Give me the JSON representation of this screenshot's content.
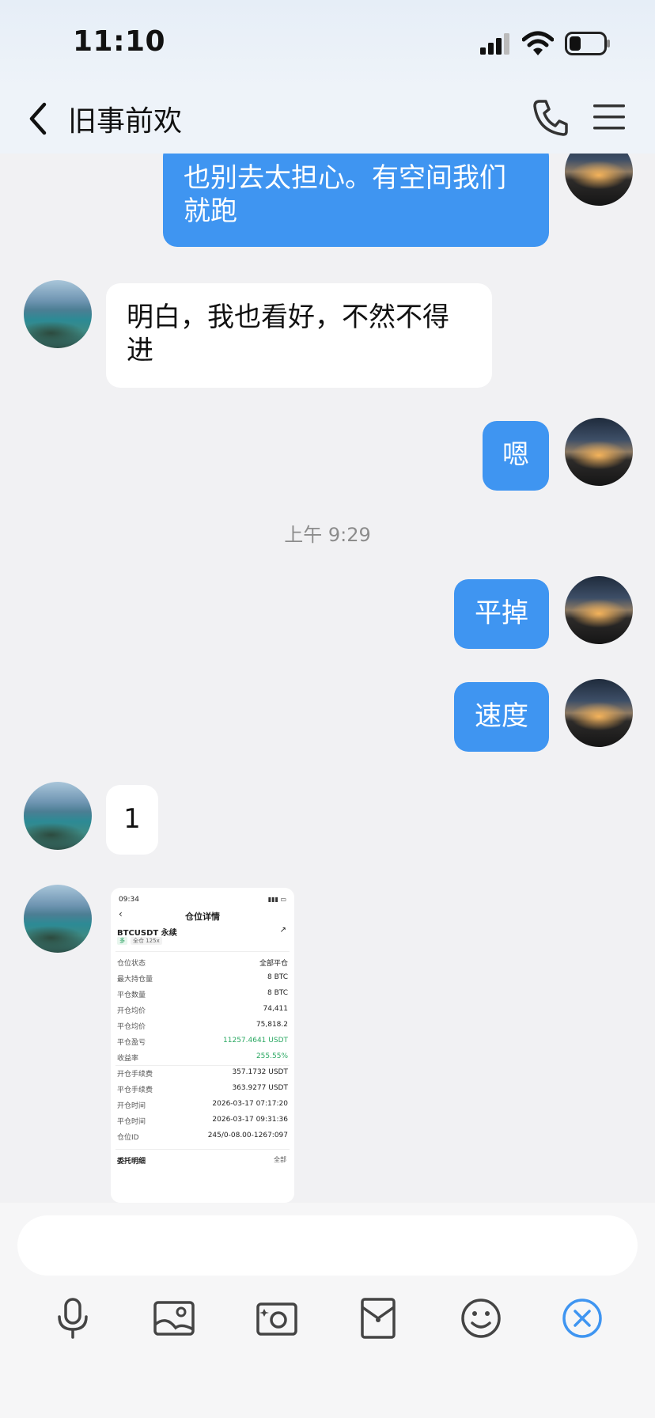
{
  "status_bar": {
    "time": "11:10"
  },
  "header": {
    "title": "旧事前欢",
    "icons": [
      "back-icon",
      "phone-icon",
      "menu-icon"
    ]
  },
  "messages": [
    {
      "side": "out",
      "text": "也别去太担心。有空间我们就跑"
    },
    {
      "side": "in",
      "text": "明白，我也看好，不然不得进"
    },
    {
      "side": "out",
      "text": "嗯"
    },
    {
      "timestamp": "上午 9:29"
    },
    {
      "side": "out",
      "text": "平掉"
    },
    {
      "side": "out",
      "text": "速度"
    },
    {
      "side": "in",
      "text": "1"
    },
    {
      "side": "in",
      "type": "image"
    }
  ],
  "screenshot": {
    "time": "09:34",
    "title": "仓位详情",
    "symbol": "BTCUSDT 永续",
    "tag_long": "多",
    "tag_leverage": "全仓 125x",
    "rows": [
      {
        "k": "仓位状态",
        "v": "全部平仓"
      },
      {
        "k": "最大持仓量",
        "v": "8 BTC"
      },
      {
        "k": "平仓数量",
        "v": "8 BTC"
      },
      {
        "k": "开仓均价",
        "v": "74,411"
      },
      {
        "k": "平仓均价",
        "v": "75,818.2"
      },
      {
        "k": "平仓盈亏",
        "v": "11257.4641 USDT"
      },
      {
        "k": "收益率",
        "v": "255.55%"
      },
      {
        "k": "开仓手续费",
        "v": "357.1732 USDT"
      },
      {
        "k": "平仓手续费",
        "v": "363.9277 USDT"
      },
      {
        "k": "开仓时间",
        "v": "2026-03-17 07:17:20"
      },
      {
        "k": "平仓时间",
        "v": "2026-03-17 09:31:36"
      },
      {
        "k": "仓位ID",
        "v": "245/0-08.00-1267:097"
      }
    ],
    "footer_left": "委托明细",
    "footer_right": "全部"
  },
  "toolbar": {
    "icons": [
      "microphone-icon",
      "image-icon",
      "camera-icon",
      "red-packet-icon",
      "emoji-icon",
      "close-icon"
    ]
  },
  "colors": {
    "bubble_out": "#3f95f1",
    "bubble_in": "#ffffff",
    "background": "#f1f1f3",
    "profit_green": "#2aa862"
  }
}
